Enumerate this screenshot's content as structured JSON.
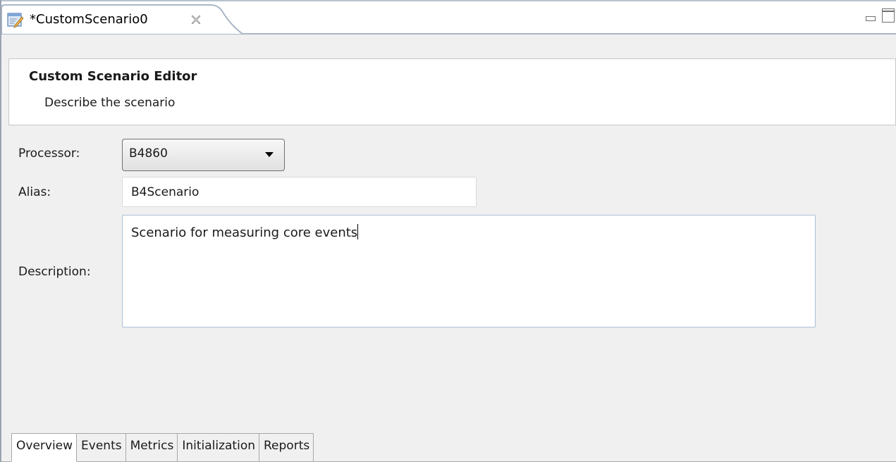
{
  "editor_tab": {
    "title": "*CustomScenario0",
    "file_icon": "edit-document-icon",
    "close_icon": "close-icon"
  },
  "window_controls": {
    "minimize_icon": "minimize-icon",
    "maximize_icon": "maximize-icon"
  },
  "header": {
    "title": "Custom Scenario Editor",
    "subtitle": "Describe the scenario"
  },
  "form": {
    "processor_label": "Processor:",
    "processor_value": "B4860",
    "alias_label": "Alias:",
    "alias_value": "B4Scenario",
    "description_label": "Description:",
    "description_value": "Scenario for measuring core events"
  },
  "page_tabs": [
    {
      "label": "Overview",
      "active": true
    },
    {
      "label": "Events",
      "active": false
    },
    {
      "label": "Metrics",
      "active": false
    },
    {
      "label": "Initialization",
      "active": false
    },
    {
      "label": "Reports",
      "active": false
    }
  ],
  "colors": {
    "tab_border": "#a9b6c6",
    "panel_background": "#f0f0f0",
    "textarea_focus_border": "#a9c0d6"
  }
}
